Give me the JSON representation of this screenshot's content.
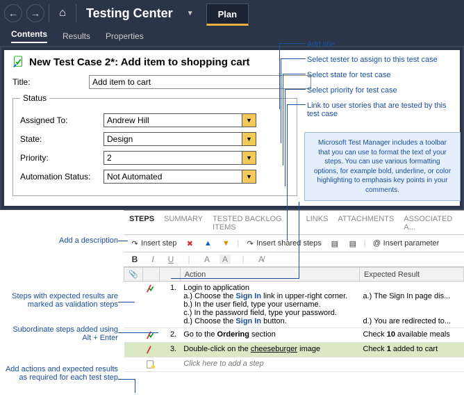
{
  "topbar": {
    "title": "Testing Center",
    "plan": "Plan"
  },
  "subtabs": {
    "contents": "Contents",
    "results": "Results",
    "properties": "Properties"
  },
  "header": {
    "title": "New Test Case 2*: Add item to shopping cart"
  },
  "fields": {
    "title_label": "Title:",
    "title_value": "Add item to cart",
    "status_legend": "Status",
    "assignedto_label": "Assigned To:",
    "assignedto_value": "Andrew Hill",
    "state_label": "State:",
    "state_value": "Design",
    "priority_label": "Priority:",
    "priority_value": "2",
    "automation_label": "Automation Status:",
    "automation_value": "Not Automated"
  },
  "steps_tabs": {
    "steps": "STEPS",
    "summary": "SUMMARY",
    "backlog": "TESTED BACKLOG ITEMS",
    "links": "LINKS",
    "attachments": "ATTACHMENTS",
    "assoc": "ASSOCIATED A..."
  },
  "toolbar": {
    "insert_step": "Insert step",
    "insert_shared": "Insert shared steps",
    "insert_param": "Insert parameter"
  },
  "grid": {
    "col_action": "Action",
    "col_expected": "Expected Result",
    "rows": [
      {
        "num": "1.",
        "action_main": "Login to application",
        "subs": [
          {
            "pre": "a.) Choose the ",
            "b": "Sign In",
            "post": " link in upper-right corner."
          },
          {
            "pre": "b.) In the user field, type your username.",
            "b": "",
            "post": ""
          },
          {
            "pre": "c.) In the password field, type your password.",
            "b": "",
            "post": ""
          },
          {
            "pre": "d.) Choose the ",
            "b": "Sign In",
            "post": " button."
          }
        ],
        "exp": [
          "a.) The Sign In page dis...",
          "",
          "",
          "d.) You are redirected to..."
        ]
      },
      {
        "num": "2.",
        "action_pre": "Go to the ",
        "action_b": "Ordering",
        "action_post": " section",
        "exp_pre": "Check ",
        "exp_b": "10",
        "exp_post": " available meals"
      },
      {
        "num": "3.",
        "action_pre": "Double-click on the ",
        "action_u": "cheeseburger",
        "action_post": " image",
        "exp_pre": "Check ",
        "exp_b": "1",
        "exp_post": " added to cart"
      }
    ],
    "add_hint": "Click here to add a step"
  },
  "annotations": {
    "add_title": "Add title",
    "sel_tester": "Select tester to assign to this test case",
    "sel_state": "Select state for test case",
    "sel_priority": "Select priority for test case",
    "link_stories": "Link to user stories that are tested by this test case",
    "tooltip": "Microsoft Test Manager includes a toolbar that you can use to format the text of your steps. You can use various formatting options, for example bold, underline, or color highlighting to emphasis key points in your comments.",
    "add_desc": "Add a description",
    "validation": "Steps with expected results are marked as validation steps",
    "subordinate": "Subordinate steps added using Alt + Enter",
    "add_actions": "Add actions and expected results as required for each test step"
  }
}
